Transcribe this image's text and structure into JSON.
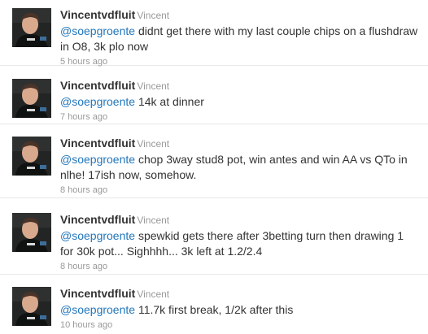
{
  "tweets": [
    {
      "screen_name": "Vincentvdfluit",
      "full_name": "Vincent",
      "mention": "@soepgroente",
      "text": " didnt get there with my last couple chips on a flushdraw in O8, 3k plo now",
      "time": "5 hours ago"
    },
    {
      "screen_name": "Vincentvdfluit",
      "full_name": "Vincent",
      "mention": "@soepgroente",
      "text": " 14k at dinner",
      "time": "7 hours ago"
    },
    {
      "screen_name": "Vincentvdfluit",
      "full_name": "Vincent",
      "mention": "@soepgroente",
      "text": " chop 3way stud8 pot, win antes and win AA vs QTo in nlhe! 17ish now, somehow.",
      "time": "8 hours ago"
    },
    {
      "screen_name": "Vincentvdfluit",
      "full_name": "Vincent",
      "mention": "@soepgroente",
      "text": " spewkid gets there after 3betting turn then drawing 1 for 30k pot... Sighhhh... 3k left at 1.2/2.4",
      "time": "8 hours ago"
    },
    {
      "screen_name": "Vincentvdfluit",
      "full_name": "Vincent",
      "mention": "@soepgroente",
      "text": " 11.7k first break, 1/2k after this",
      "time": "10 hours ago"
    }
  ]
}
